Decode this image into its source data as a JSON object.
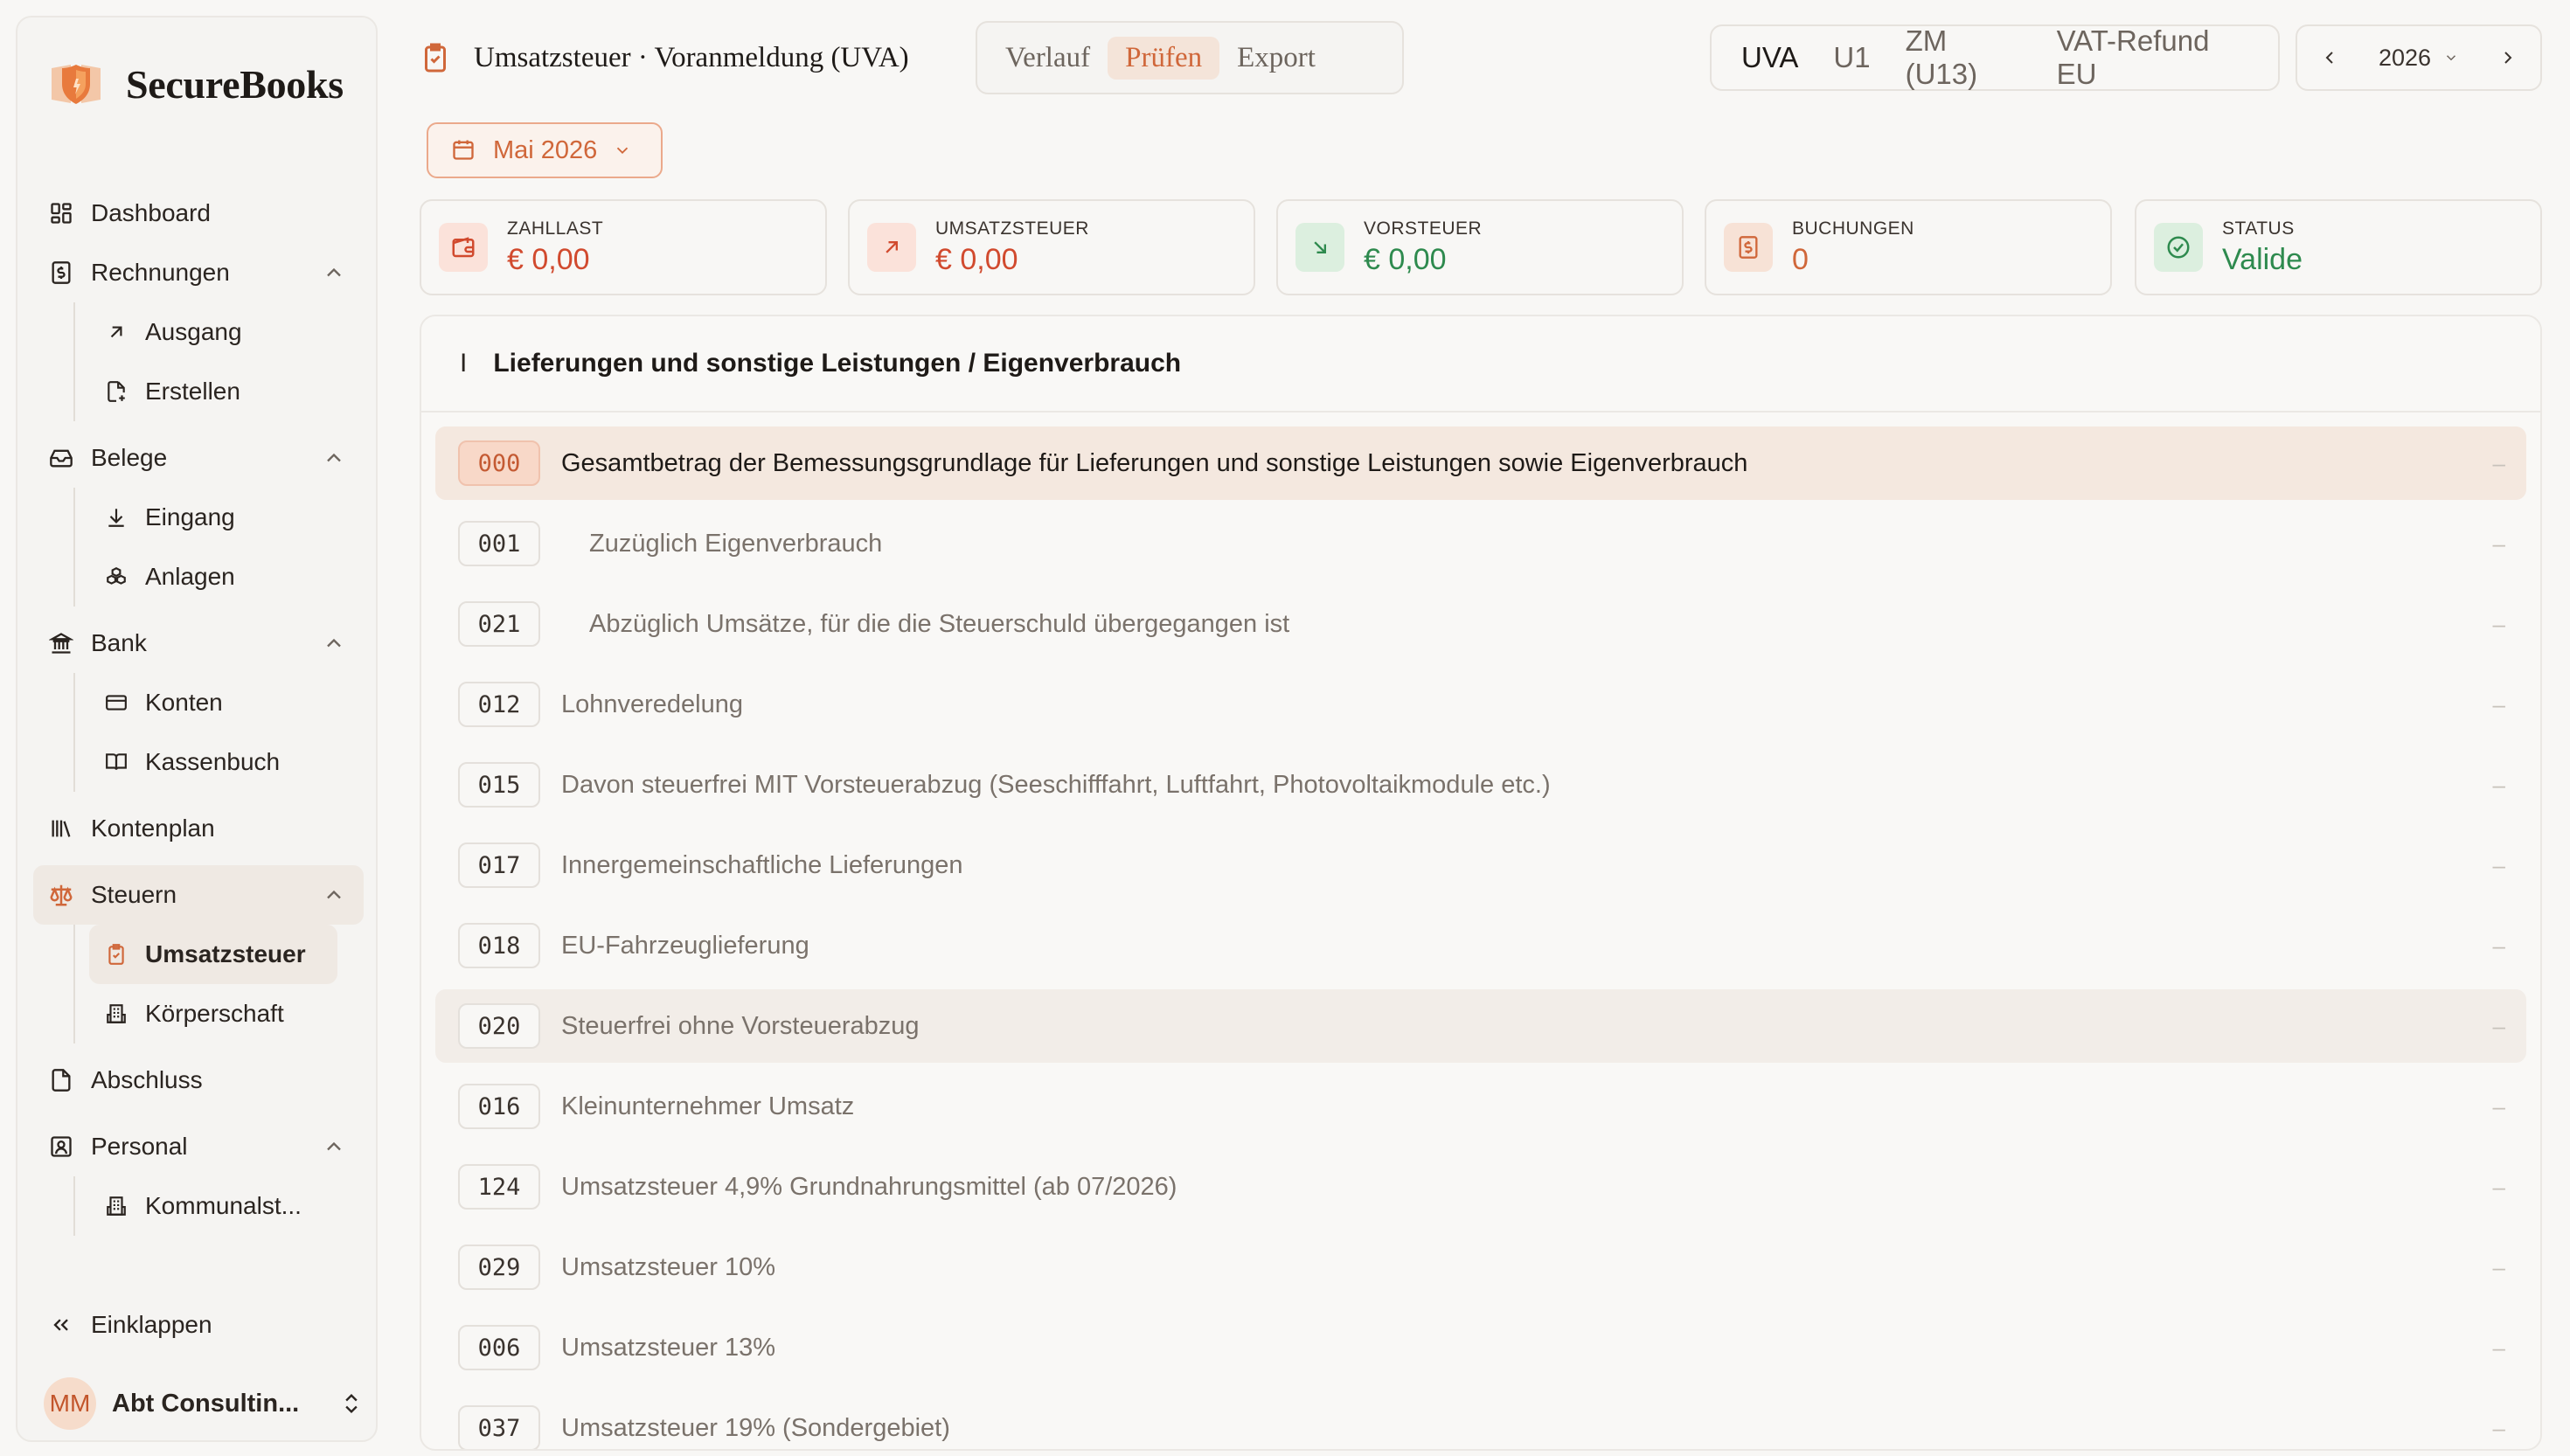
{
  "brand": {
    "name": "SecureBooks"
  },
  "sidebar": {
    "items": [
      {
        "key": "dashboard",
        "label": "Dashboard"
      },
      {
        "key": "rechnungen",
        "label": "Rechnungen",
        "children": [
          {
            "label": "Ausgang"
          },
          {
            "label": "Erstellen"
          }
        ]
      },
      {
        "key": "belege",
        "label": "Belege",
        "children": [
          {
            "label": "Eingang"
          },
          {
            "label": "Anlagen"
          }
        ]
      },
      {
        "key": "bank",
        "label": "Bank",
        "children": [
          {
            "label": "Konten"
          },
          {
            "label": "Kassenbuch"
          }
        ]
      },
      {
        "key": "kontenplan",
        "label": "Kontenplan"
      },
      {
        "key": "steuern",
        "label": "Steuern",
        "active": true,
        "children": [
          {
            "label": "Umsatzsteuer",
            "active": true
          },
          {
            "label": "Körperschaft"
          }
        ]
      },
      {
        "key": "abschluss",
        "label": "Abschluss"
      },
      {
        "key": "personal",
        "label": "Personal",
        "children": [
          {
            "label": "Kommunalst..."
          }
        ]
      }
    ],
    "collapse_label": "Einklappen",
    "user": {
      "initials": "MM",
      "name": "Abt Consultin..."
    }
  },
  "header": {
    "title": "Umsatzsteuer · Voranmeldung (UVA)",
    "view_tabs": [
      "Verlauf",
      "Prüfen",
      "Export"
    ],
    "view_tab_active": "Prüfen",
    "form_tabs": [
      "UVA",
      "U1",
      "ZM (U13)",
      "VAT-Refund EU"
    ],
    "form_tab_active": "UVA",
    "year": "2026",
    "month": "Mai 2026"
  },
  "kpis": [
    {
      "label": "ZAHLLAST",
      "value": "€ 0,00",
      "color": "#d14a2e"
    },
    {
      "label": "UMSATZSTEUER",
      "value": "€ 0,00",
      "color": "#d14a2e"
    },
    {
      "label": "VORSTEUER",
      "value": "€ 0,00",
      "color": "#2e8a4e"
    },
    {
      "label": "BUCHUNGEN",
      "value": "0",
      "color": "#d0673a"
    },
    {
      "label": "STATUS",
      "value": "Valide",
      "color": "#2e8a4e"
    }
  ],
  "section": {
    "roman": "I",
    "title": "Lieferungen und sonstige Leistungen / Eigenverbrauch",
    "rows": [
      {
        "code": "000",
        "desc": "Gesamtbetrag der Bemessungsgrundlage für Lieferungen und sonstige Leistungen sowie Eigenverbrauch",
        "value": "–"
      },
      {
        "code": "001",
        "desc": "Zuzüglich Eigenverbrauch",
        "value": "–"
      },
      {
        "code": "021",
        "desc": "Abzüglich Umsätze, für die die Steuerschuld übergegangen ist",
        "value": "–"
      },
      {
        "code": "012",
        "desc": "Lohnveredelung",
        "value": "–"
      },
      {
        "code": "015",
        "desc": "Davon steuerfrei MIT Vorsteuerabzug (Seeschifffahrt, Luftfahrt, Photovoltaikmodule etc.)",
        "value": "–"
      },
      {
        "code": "017",
        "desc": "Innergemeinschaftliche Lieferungen",
        "value": "–"
      },
      {
        "code": "018",
        "desc": "EU-Fahrzeuglieferung",
        "value": "–"
      },
      {
        "code": "020",
        "desc": "Steuerfrei ohne Vorsteuerabzug",
        "value": "–"
      },
      {
        "code": "016",
        "desc": "Kleinunternehmer Umsatz",
        "value": "–"
      },
      {
        "code": "124",
        "desc": "Umsatzsteuer 4,9% Grundnahrungsmittel (ab 07/2026)",
        "value": "–"
      },
      {
        "code": "029",
        "desc": "Umsatzsteuer 10%",
        "value": "–"
      },
      {
        "code": "006",
        "desc": "Umsatzsteuer 13%",
        "value": "–"
      },
      {
        "code": "037",
        "desc": "Umsatzsteuer 19% (Sondergebiet)",
        "value": "–"
      }
    ]
  },
  "colors": {
    "accent": "#d0673a",
    "positive": "#2e8a4e",
    "negative": "#d14a2e"
  }
}
